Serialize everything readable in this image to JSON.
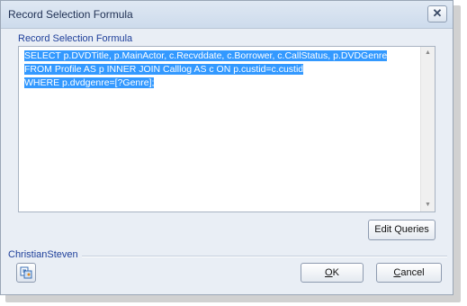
{
  "window": {
    "title": "Record Selection Formula",
    "close_glyph": "✕"
  },
  "formula": {
    "label": "Record Selection Formula",
    "lines": [
      "SELECT p.DVDTitle, p.MainActor, c.Recvddate, c.Borrower, c.CallStatus, p.DVDGenre",
      "FROM Profile AS p INNER JOIN Calllog AS c ON p.custid=c.custid",
      "WHERE p.dvdgenre=[?Genre];"
    ],
    "selection_color": "#3399ff"
  },
  "buttons": {
    "edit_queries": "Edit Queries",
    "ok_letter": "O",
    "ok_rest": "K",
    "cancel_letter": "C",
    "cancel_rest": "ancel"
  },
  "footer": {
    "brand": "ChristianSteven",
    "tool_icon": "dialog-tool-icon"
  },
  "colors": {
    "accent": "#1e3f9a",
    "dialog_bg": "#e9eef5"
  }
}
